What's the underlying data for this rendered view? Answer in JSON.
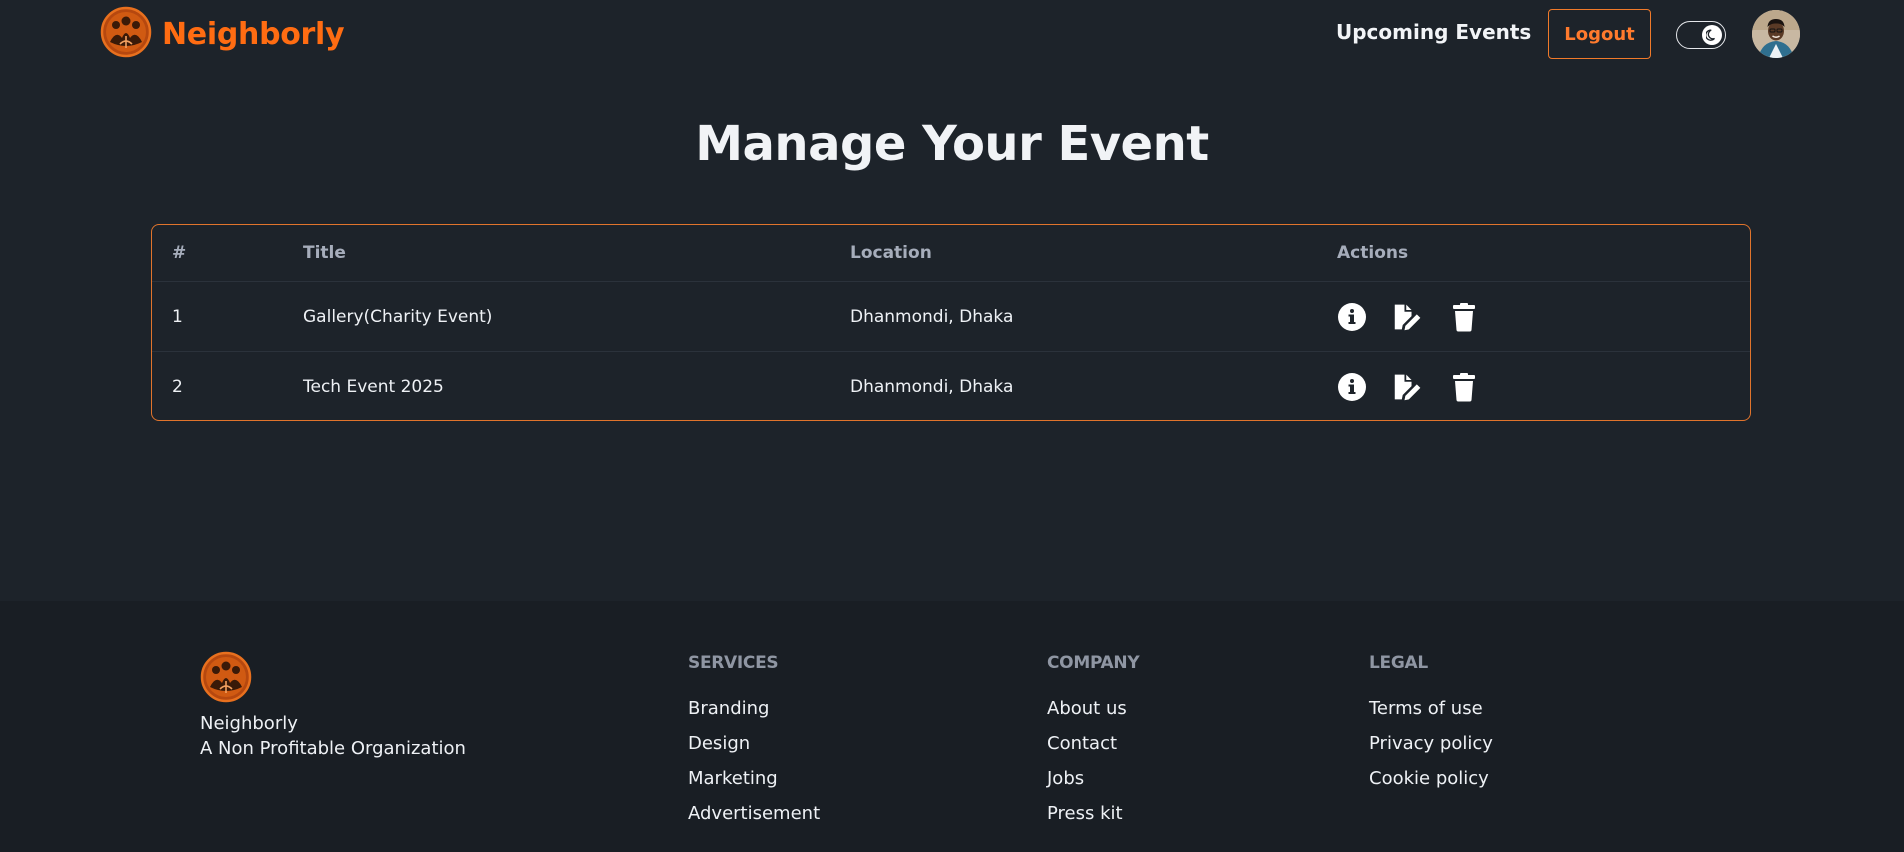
{
  "navbar": {
    "brand_name": "Neighborly",
    "upcoming_events": "Upcoming Events",
    "logout": "Logout"
  },
  "page": {
    "title": "Manage Your Event"
  },
  "table": {
    "headers": [
      "#",
      "Title",
      "Location",
      "Actions"
    ],
    "rows": [
      {
        "num": "1",
        "title": "Gallery(Charity Event)",
        "location": "Dhanmondi, Dhaka"
      },
      {
        "num": "2",
        "title": "Tech Event 2025",
        "location": "Dhanmondi, Dhaka"
      }
    ]
  },
  "footer": {
    "brand_name": "Neighborly",
    "tagline": "A Non Profitable Organization",
    "services": {
      "heading": "SERVICES",
      "links": [
        "Branding",
        "Design",
        "Marketing",
        "Advertisement"
      ]
    },
    "company": {
      "heading": "COMPANY",
      "links": [
        "About us",
        "Contact",
        "Jobs",
        "Press kit"
      ]
    },
    "legal": {
      "heading": "LEGAL",
      "links": [
        "Terms of use",
        "Privacy policy",
        "Cookie policy"
      ]
    }
  },
  "colors": {
    "background": "#1d232a",
    "footer_background": "#191e24",
    "accent": "#ff6c12",
    "table_border": "#e0742c"
  },
  "icons": [
    "logo-icon",
    "moon-icon",
    "info-icon",
    "edit-file-icon",
    "trash-icon"
  ]
}
